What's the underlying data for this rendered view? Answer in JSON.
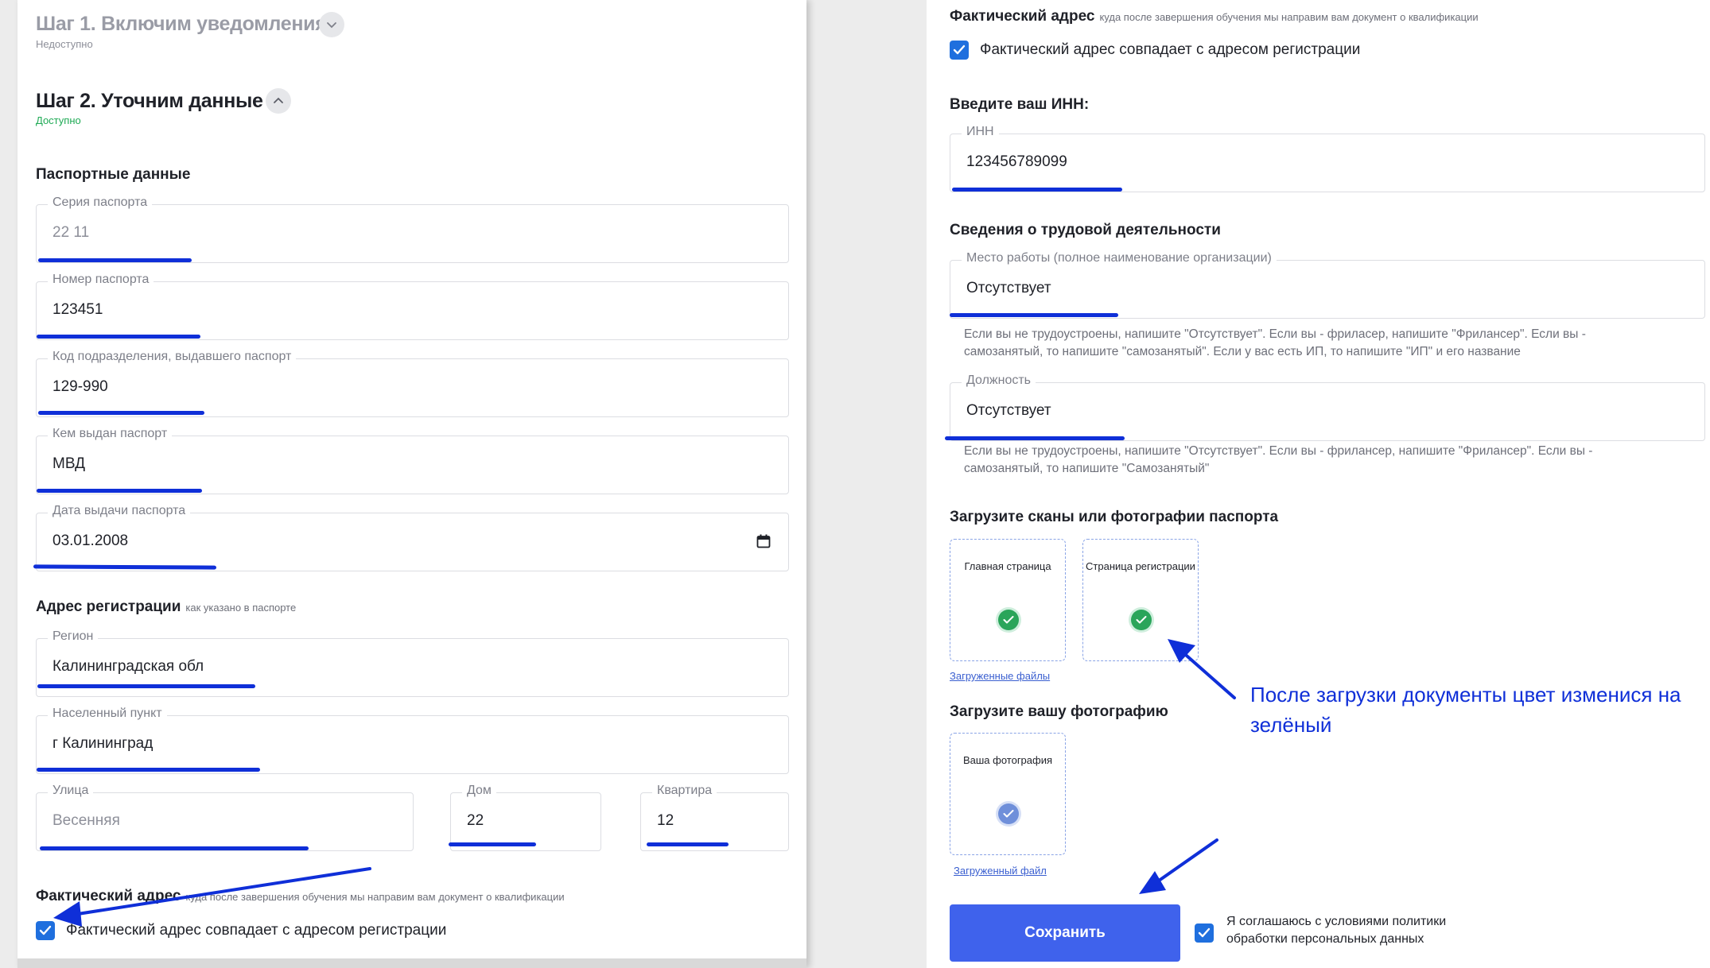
{
  "steps": {
    "step1": {
      "title": "Шаг 1. Включим уведомления",
      "status": "Недоступно"
    },
    "step2": {
      "title": "Шаг 2. Уточним данные",
      "status": "Доступно"
    }
  },
  "passport": {
    "title": "Паспортные данные",
    "series": {
      "label": "Серия паспорта",
      "value": "22 11"
    },
    "number": {
      "label": "Номер паспорта",
      "value": "123451"
    },
    "division_code": {
      "label": "Код подразделения, выдавшего паспорт",
      "value": "129-990"
    },
    "issued_by": {
      "label": "Кем выдан паспорт",
      "value": "МВД"
    },
    "issue_date": {
      "label": "Дата выдачи паспорта",
      "value": "03.01.2008"
    }
  },
  "registration": {
    "title": "Адрес регистрации",
    "note": "как указано в паспорте",
    "region": {
      "label": "Регион",
      "value": "Калининградская обл"
    },
    "city": {
      "label": "Населенный пункт",
      "value": "г Калининград"
    },
    "street": {
      "label": "Улица",
      "value": "Весенняя"
    },
    "house": {
      "label": "Дом",
      "value": "22"
    },
    "apartment": {
      "label": "Квартира",
      "value": "12"
    }
  },
  "actual_address": {
    "title": "Фактический адрес",
    "note": "куда после завершения обучения мы направим вам документ о квалификации",
    "same_checkbox": "Фактический адрес совпадает с адресом регистрации"
  },
  "inn": {
    "title": "Введите ваш ИНН:",
    "label": "ИНН",
    "value": "123456789099"
  },
  "employment": {
    "title": "Сведения о трудовой деятельности",
    "workplace": {
      "label": "Место работы (полное наименование организации)",
      "value": "Отсутствует",
      "hint": "Если вы не трудоустроены, напишите \"Отсутствует\". Если вы - фриласер, напишите \"Фрилансер\". Если вы - самозанятый, то напишите \"самозанятый\". Если у вас есть ИП, то напишите \"ИП\" и его название"
    },
    "position": {
      "label": "Должность",
      "value": "Отсутствует",
      "hint": "Если вы не трудоустроены, напишите \"Отсутствует\". Если вы - фрилансер, напишите \"Фрилансер\". Если вы - самозанятый, то напишите \"Самозанятый\""
    }
  },
  "passport_scans": {
    "title": "Загрузите сканы или фотографии паспорта",
    "main_page": "Главная страница",
    "registration_page": "Страница регистрации",
    "uploaded_link": "Загруженные файлы"
  },
  "photo": {
    "title": "Загрузите вашу фотографию",
    "box_label": "Ваша фотография",
    "uploaded_link": "Загруженный файл"
  },
  "actions": {
    "save": "Сохранить",
    "consent": "Я соглашаюсь с условиями политики обработки персональных данных"
  },
  "annotation": {
    "text": "После загрузки документы цвет изменися на зелёный"
  },
  "colors": {
    "accent": "#3f62ec",
    "success": "#2aa55a",
    "annotation": "#0f2fd8"
  }
}
